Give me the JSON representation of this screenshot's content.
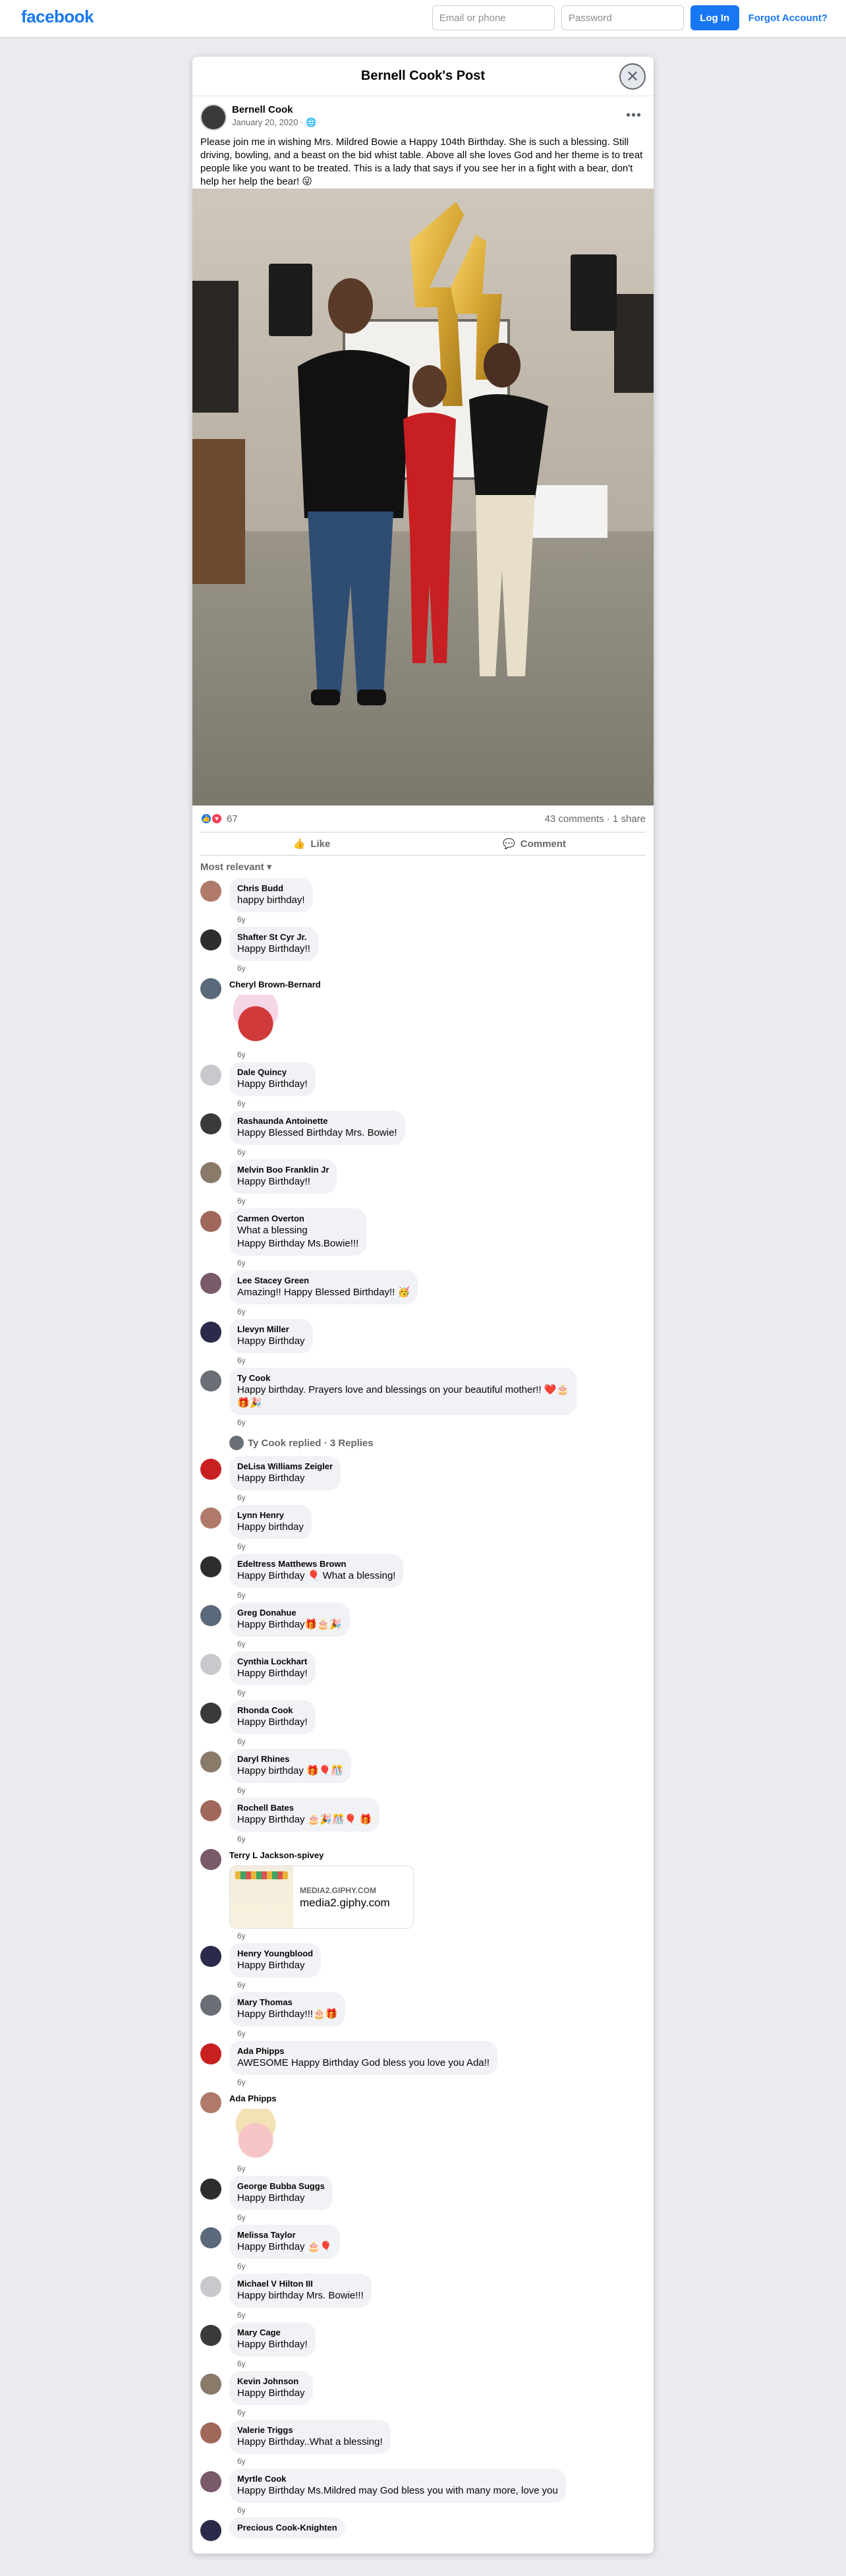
{
  "topbar": {
    "logo": "facebook",
    "email_placeholder": "Email or phone",
    "password_placeholder": "Password",
    "login_label": "Log In",
    "forgot_label": "Forgot Account?"
  },
  "modal": {
    "title": "Bernell Cook's Post"
  },
  "post": {
    "author": "Bernell Cook",
    "date": "January 20, 2020 · ",
    "text": "Please join me in wishing Mrs. Mildred Bowie a Happy 104th Birthday. She is such a blessing.  Still driving, bowling, and a beast on the bid whist table. Above all she loves God and her theme is to treat people like you want to be treated. This is a lady that says if you see her in a fight with a bear, don't help her help the bear! 😜",
    "reactions_count": "67",
    "comments_count": "43 comments",
    "shares_count": "1 share",
    "like_label": "Like",
    "comment_label": "Comment",
    "sort_label": "Most relevant"
  },
  "comments": [
    {
      "name": "Chris Budd",
      "text": "happy birthday!",
      "time": "6y"
    },
    {
      "name": "Shafter St Cyr Jr.",
      "text": "Happy Birthday!!",
      "time": "6y"
    },
    {
      "name": "Cheryl Brown-Bernard",
      "text": "",
      "time": "6y",
      "sticker": "birthday-cake-sticker"
    },
    {
      "name": "Dale Quincy",
      "text": "Happy Birthday!",
      "time": "6y"
    },
    {
      "name": "Rashaunda Antoinette",
      "text": "Happy Blessed Birthday Mrs. Bowie!",
      "time": "6y"
    },
    {
      "name": "Melvin Boo Franklin Jr",
      "text": "Happy Birthday!!",
      "time": "6y"
    },
    {
      "name": "Carmen Overton",
      "text": "What a blessing\nHappy Birthday Ms.Bowie!!!",
      "time": "6y"
    },
    {
      "name": "Lee Stacey Green",
      "text": "Amazing!! Happy Blessed Birthday!! 🥳",
      "time": "6y"
    },
    {
      "name": "Llevyn Miller",
      "text": "Happy Birthday",
      "time": "6y"
    },
    {
      "name": "Ty Cook",
      "text": "Happy birthday. Prayers love and blessings on your beautiful mother!! ❤️🎂\n🎁🎉",
      "time": "6y",
      "replies": "Ty Cook replied · 3 Replies"
    },
    {
      "name": "DeLisa Williams Zeigler",
      "text": "Happy Birthday",
      "time": "6y"
    },
    {
      "name": "Lynn Henry",
      "text": "Happy birthday",
      "time": "6y"
    },
    {
      "name": "Edeltress Matthews Brown",
      "text": "Happy Birthday 🎈 What a blessing!",
      "time": "6y"
    },
    {
      "name": "Greg Donahue",
      "text": "Happy Birthday🎁🎂🎉",
      "time": "6y"
    },
    {
      "name": "Cynthia Lockhart",
      "text": "Happy Birthday!",
      "time": "6y"
    },
    {
      "name": "Rhonda Cook",
      "text": "Happy Birthday!",
      "time": "6y"
    },
    {
      "name": "Daryl Rhines",
      "text": "Happy birthday 🎁🎈🎊",
      "time": "6y"
    },
    {
      "name": "Rochell Bates",
      "text": "Happy Birthday 🎂🎉🎊🎈 🎁",
      "time": "6y"
    },
    {
      "name": "Terry L Jackson-spivey",
      "text": "",
      "time": "6y",
      "link": {
        "domain": "MEDIA2.GIPHY.COM",
        "title": "media2.giphy.com"
      }
    },
    {
      "name": "Henry Youngblood",
      "text": "Happy Birthday",
      "time": "6y"
    },
    {
      "name": "Mary Thomas",
      "text": "Happy Birthday!!!🎂🎁",
      "time": "6y"
    },
    {
      "name": "Ada Phipps",
      "text": "AWESOME Happy Birthday God bless you love you Ada!!",
      "time": "6y"
    },
    {
      "name": "Ada Phipps",
      "text": "",
      "time": "6y",
      "sticker": "cake-sticker"
    },
    {
      "name": "George Bubba Suggs",
      "text": "Happy Birthday",
      "time": "6y"
    },
    {
      "name": "Melissa Taylor",
      "text": "Happy Birthday 🎂🎈",
      "time": "6y"
    },
    {
      "name": "Michael V Hilton III",
      "text": "Happy birthday Mrs. Bowie!!!",
      "time": "6y"
    },
    {
      "name": "Mary Cage",
      "text": "Happy Birthday!",
      "time": "6y"
    },
    {
      "name": "Kevin Johnson",
      "text": "Happy Birthday",
      "time": "6y"
    },
    {
      "name": "Valerie Triggs",
      "text": "Happy Birthday..What a blessing!",
      "time": "6y"
    },
    {
      "name": "Myrtle Cook",
      "text": "Happy Birthday Ms.Mildred may God bless you with many more, love you",
      "time": "6y"
    },
    {
      "name": "Precious Cook-Knighten",
      "text": "",
      "time": ""
    }
  ],
  "colors": {
    "brand": "#1877f2",
    "background": "#e9ebee"
  },
  "icons": {
    "close": "close-icon",
    "globe": "globe-icon",
    "more": "more-icon",
    "like": "like-icon",
    "comment": "comment-icon",
    "chevron": "chevron-down-icon"
  }
}
